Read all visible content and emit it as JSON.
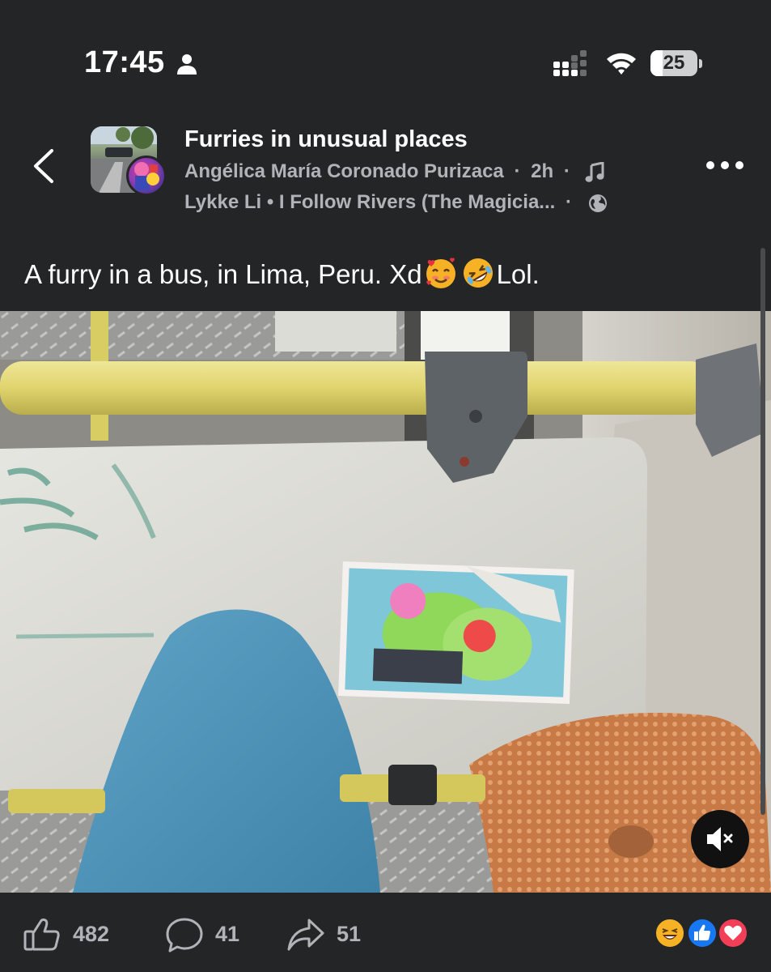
{
  "status_bar": {
    "time": "17:45",
    "battery_level": "25",
    "battery_fraction": 0.25,
    "icons": [
      "person-icon",
      "cellular-signal-icon",
      "wifi-icon",
      "battery-icon"
    ]
  },
  "header": {
    "group_name": "Furries in unusual places",
    "author": "Angélica María Coronado Purizaca",
    "time_ago": "2h",
    "separator": "·",
    "music": "Lykke Li • I Follow Rivers (The Magicia...",
    "icons": [
      "chevron-left-icon",
      "music-note-icon",
      "globe-icon",
      "more-horizontal-icon"
    ]
  },
  "post": {
    "caption_text": "A furry in a bus, in Lima, Peru. Xd",
    "caption_end": "Lol.",
    "emojis": [
      "smiling-face-with-hearts-emoji",
      "rolling-on-floor-laughing-emoji"
    ]
  },
  "media": {
    "mute_icon": "speaker-muted-icon"
  },
  "actions": {
    "likes": "482",
    "comments": "41",
    "shares": "51",
    "reactions": [
      "haha",
      "like",
      "love"
    ]
  },
  "colors": {
    "background": "#242526",
    "text_primary": "#ffffff",
    "text_secondary": "#b0b3b8",
    "like_blue": "#1877f2",
    "love_red": "#f33e58",
    "haha_yellow": "#f7b125"
  }
}
